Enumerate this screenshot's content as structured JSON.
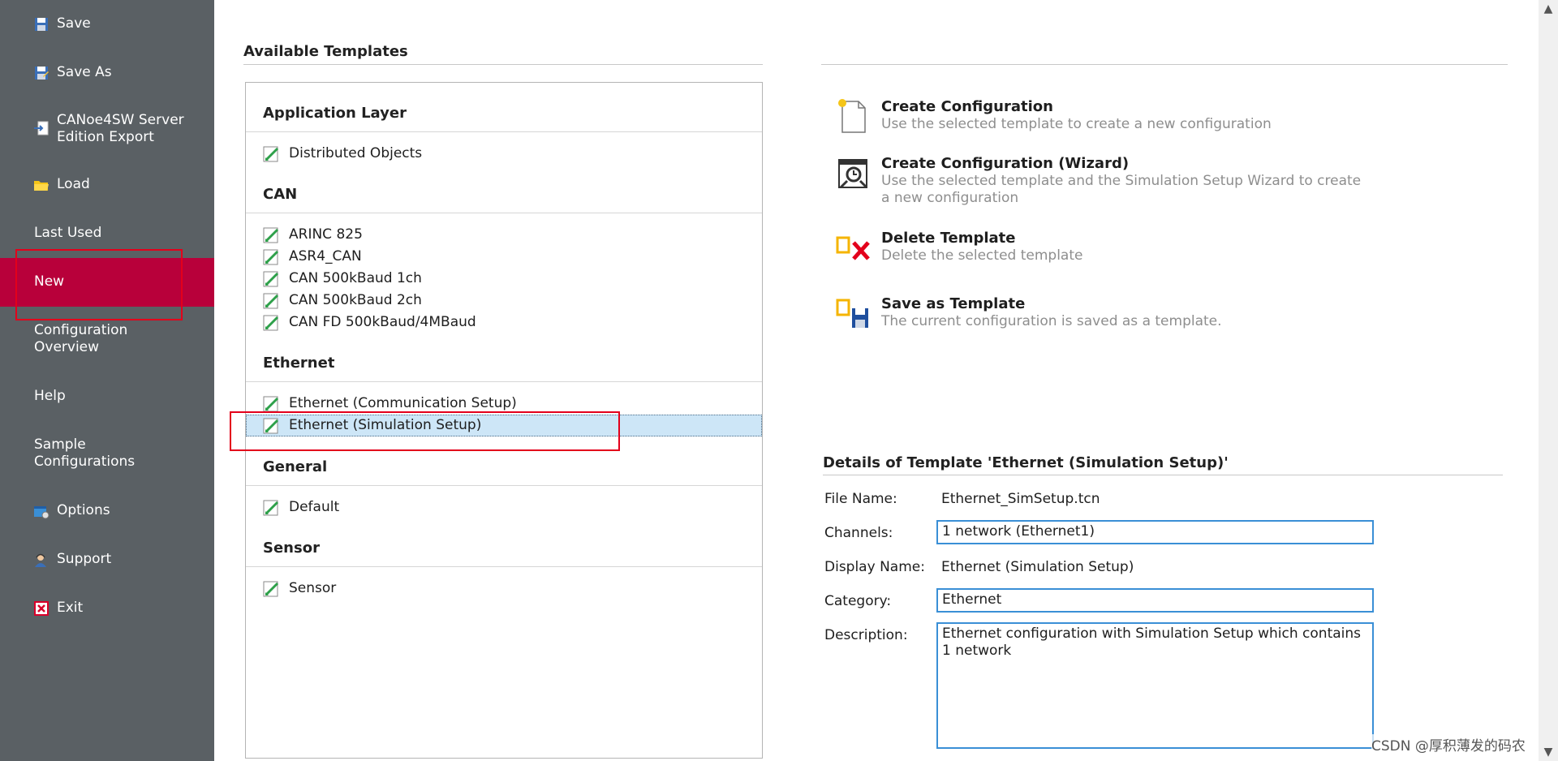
{
  "sidebar": {
    "items": [
      {
        "label": "Save",
        "icon": "save-icon"
      },
      {
        "label": "Save As",
        "icon": "save-as-icon"
      },
      {
        "label": "CANoe4SW Server\nEdition Export",
        "icon": "export-icon"
      },
      {
        "label": "Load",
        "icon": "folder-icon"
      },
      {
        "label": "Last Used"
      },
      {
        "label": "New",
        "active": true
      },
      {
        "label": "Configuration\nOverview"
      },
      {
        "label": "Help"
      },
      {
        "label": "Sample\nConfigurations"
      },
      {
        "label": "Options",
        "icon": "options-icon"
      },
      {
        "label": "Support",
        "icon": "support-icon"
      },
      {
        "label": "Exit",
        "icon": "exit-icon"
      }
    ],
    "colors": {
      "background": "#5a6064",
      "active": "#b8003a"
    }
  },
  "templates": {
    "title": "Available Templates",
    "groups": [
      {
        "name": "Application Layer",
        "items": [
          "Distributed Objects"
        ]
      },
      {
        "name": "CAN",
        "items": [
          "ARINC 825",
          "ASR4_CAN",
          "CAN 500kBaud 1ch",
          "CAN 500kBaud 2ch",
          "CAN FD 500kBaud/4MBaud"
        ]
      },
      {
        "name": "Ethernet",
        "items": [
          "Ethernet (Communication Setup)",
          "Ethernet (Simulation Setup)"
        ]
      },
      {
        "name": "General",
        "items": [
          "Default"
        ]
      },
      {
        "name": "Sensor",
        "items": [
          "Sensor"
        ]
      }
    ],
    "selected": "Ethernet (Simulation Setup)"
  },
  "actions": [
    {
      "title": "Create Configuration",
      "desc": "Use the selected template to create a new configuration",
      "icon": "new-document-icon"
    },
    {
      "title": "Create Configuration (Wizard)",
      "desc": "Use the selected template and the Simulation Setup Wizard to create a new configuration",
      "icon": "wizard-icon"
    },
    {
      "title": "Delete Template",
      "desc": "Delete the selected template",
      "icon": "delete-template-icon"
    },
    {
      "title": "Save as Template",
      "desc": "The current configuration is saved as a template.",
      "icon": "save-template-icon"
    }
  ],
  "details": {
    "title": "Details of Template 'Ethernet (Simulation Setup)'",
    "file_name_label": "File Name:",
    "file_name": "Ethernet_SimSetup.tcn",
    "channels_label": "Channels:",
    "channels": "1 network (Ethernet1)",
    "display_name_label": "Display Name:",
    "display_name": "Ethernet (Simulation Setup)",
    "category_label": "Category:",
    "category": "Ethernet",
    "description_label": "Description:",
    "description": "Ethernet configuration with Simulation Setup which contains 1 network"
  },
  "watermark": "CSDN @厚积薄发的码农",
  "accent_color": "#3a8fd6",
  "highlight_color": "#e3001b"
}
